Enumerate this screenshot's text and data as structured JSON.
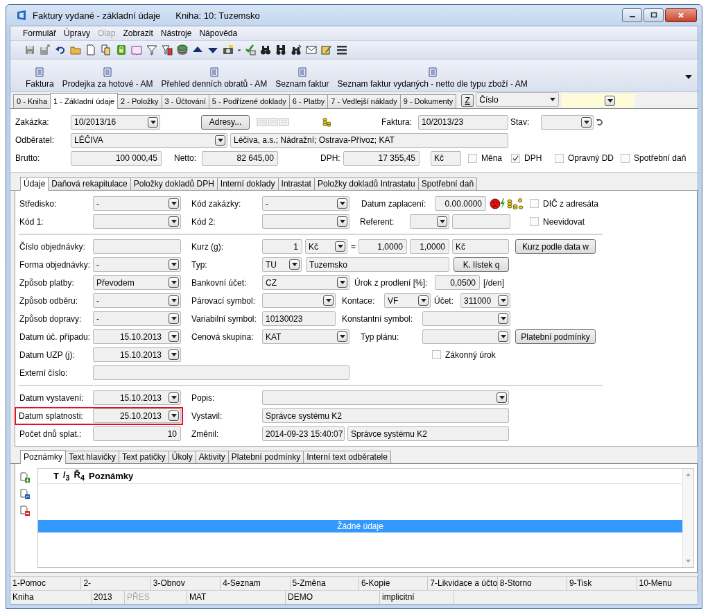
{
  "window": {
    "title": "Faktury vydané - základní údaje",
    "subtitle": "Kniha: 10: Tuzemsko"
  },
  "menu": [
    {
      "label": "Formulář",
      "disabled": false
    },
    {
      "label": "Úpravy",
      "disabled": false
    },
    {
      "label": "Olap",
      "disabled": true
    },
    {
      "label": "Zobrazit",
      "disabled": false
    },
    {
      "label": "Nástroje",
      "disabled": false
    },
    {
      "label": "Nápověda",
      "disabled": false
    }
  ],
  "reports": [
    "Faktura",
    "Prodejka za hotové - AM",
    "Přehled denních obratů - AM",
    "Seznam faktur",
    "Seznam faktur vydaných - netto dle typu zboží - AM"
  ],
  "tabs": [
    {
      "label": "0 - Kniha",
      "selected": false
    },
    {
      "label": "1 - Základní údaje",
      "selected": true
    },
    {
      "label": "2 - Položky",
      "selected": false
    },
    {
      "label": "3 - Účtování",
      "selected": false
    },
    {
      "label": "5 - Podřízené doklady",
      "selected": false
    },
    {
      "label": "6 - Platby",
      "selected": false
    },
    {
      "label": "7 - Vedlejší náklady",
      "selected": false
    },
    {
      "label": "9 - Dokumenty",
      "selected": false
    }
  ],
  "sort": {
    "key": "Z",
    "field": "Číslo"
  },
  "header": {
    "rows": [
      {
        "items": [
          {
            "kind": "label",
            "text": "Zakázka:"
          },
          {
            "kind": "combo",
            "value": "10/2013/16"
          },
          {
            "kind": "button",
            "label": "Adresy..."
          },
          {
            "kind": "pages"
          },
          {
            "kind": "coins"
          },
          {
            "kind": "label",
            "text": "Faktura:"
          },
          {
            "kind": "field",
            "value": "10/2013/23"
          },
          {
            "kind": "label",
            "text": "Stav:"
          },
          {
            "kind": "combo"
          },
          {
            "kind": "undo"
          }
        ]
      },
      {
        "items": [
          {
            "kind": "label",
            "text": "Odběratel:"
          },
          {
            "kind": "combo",
            "value": "LÉČIVA"
          },
          {
            "kind": "field",
            "value": "Léčiva, a.s.; Nádražní; Ostrava-Přívoz; KAT"
          }
        ]
      },
      {
        "items": [
          {
            "kind": "label",
            "text": "Brutto:"
          },
          {
            "kind": "numfield",
            "value": "100 000,45"
          },
          {
            "kind": "label",
            "text": "Netto:"
          },
          {
            "kind": "numfield",
            "value": "82 645,00"
          },
          {
            "kind": "label",
            "text": "DPH:"
          },
          {
            "kind": "numfield",
            "value": "17 355,45"
          },
          {
            "kind": "field",
            "value": "Kč"
          },
          {
            "kind": "check",
            "label": "Měna",
            "checked": false
          },
          {
            "kind": "check",
            "label": "DPH",
            "checked": true
          },
          {
            "kind": "check",
            "label": "Opravný DD",
            "checked": false
          },
          {
            "kind": "check",
            "label": "Spotřební daň",
            "checked": false
          }
        ]
      }
    ]
  },
  "detail_tabs": [
    {
      "label": "Údaje",
      "selected": true
    },
    {
      "label": "Daňová rekapitulace",
      "selected": false
    },
    {
      "label": "Položky dokladů DPH",
      "selected": false
    },
    {
      "label": "Interní doklady",
      "selected": false
    },
    {
      "label": "Intrastat",
      "selected": false
    },
    {
      "label": "Položky dokladů Intrastatu",
      "selected": false
    },
    {
      "label": "Spotřební daň",
      "selected": false
    }
  ],
  "detail": {
    "groups": [
      [
        {
          "items": [
            {
              "kind": "label",
              "text": "Středisko:"
            },
            {
              "kind": "combo",
              "value": "-"
            },
            {
              "kind": "label",
              "text": "Kód zakázky:"
            },
            {
              "kind": "combo",
              "value": "-"
            },
            {
              "kind": "label",
              "text": "Datum zaplacení:"
            },
            {
              "kind": "numfield",
              "value": "0.00.0000"
            },
            {
              "kind": "payment"
            },
            {
              "kind": "check",
              "label": "DIČ z adresáta",
              "checked": false
            }
          ]
        },
        {
          "items": [
            {
              "kind": "label",
              "text": "Kód 1:"
            },
            {
              "kind": "combo"
            },
            {
              "kind": "label",
              "text": "Kód 2:"
            },
            {
              "kind": "combo"
            },
            {
              "kind": "label",
              "text": "Referent:"
            },
            {
              "kind": "combo"
            },
            {
              "kind": "field"
            },
            {
              "kind": "check",
              "label": "Neevidovat",
              "checked": false
            }
          ]
        }
      ],
      [
        {
          "items": [
            {
              "kind": "label",
              "text": "Číslo objednávky:"
            },
            {
              "kind": "field"
            },
            {
              "kind": "label",
              "text": "Kurz (g):"
            },
            {
              "kind": "numfield",
              "value": "1"
            },
            {
              "kind": "combo",
              "value": "Kč"
            },
            {
              "kind": "text",
              "text": "="
            },
            {
              "kind": "numfield",
              "value": "1,0000"
            },
            {
              "kind": "numfield",
              "value": "1,0000"
            },
            {
              "kind": "field",
              "value": "Kč"
            },
            {
              "kind": "button",
              "label": "Kurz podle data w"
            }
          ]
        },
        {
          "items": [
            {
              "kind": "label",
              "text": "Forma objednávky:"
            },
            {
              "kind": "combo",
              "value": "-"
            },
            {
              "kind": "label",
              "text": "Typ:"
            },
            {
              "kind": "combo",
              "value": "TU"
            },
            {
              "kind": "field",
              "value": "Tuzemsko"
            },
            {
              "kind": "button",
              "label": "K. lístek q"
            }
          ]
        },
        {
          "items": [
            {
              "kind": "label",
              "text": "Způsob platby:"
            },
            {
              "kind": "combo",
              "value": "Převodem"
            },
            {
              "kind": "label",
              "text": "Bankovní účet:"
            },
            {
              "kind": "combo",
              "value": "CZ"
            },
            {
              "kind": "label",
              "text": "Úrok z prodlení [%]:"
            },
            {
              "kind": "numfield",
              "value": "0,0500"
            },
            {
              "kind": "text",
              "text": "[/den]"
            }
          ]
        },
        {
          "items": [
            {
              "kind": "label",
              "text": "Způsob odběru:"
            },
            {
              "kind": "combo",
              "value": "-"
            },
            {
              "kind": "label",
              "text": "Párovací symbol:"
            },
            {
              "kind": "combo"
            },
            {
              "kind": "label",
              "text": "Kontace:"
            },
            {
              "kind": "combo",
              "value": "VF"
            },
            {
              "kind": "label",
              "text": "Účet:"
            },
            {
              "kind": "combo",
              "value": "311000"
            }
          ]
        },
        {
          "items": [
            {
              "kind": "label",
              "text": "Způsob dopravy:"
            },
            {
              "kind": "combo",
              "value": "-"
            },
            {
              "kind": "label",
              "text": "Variabilní symbol:"
            },
            {
              "kind": "field",
              "value": "10130023"
            },
            {
              "kind": "label",
              "text": "Konstantní symbol:"
            },
            {
              "kind": "combo"
            }
          ]
        },
        {
          "items": [
            {
              "kind": "label",
              "text": "Datum úč. případu:"
            },
            {
              "kind": "datecombo",
              "value": "15.10.2013"
            },
            {
              "kind": "label",
              "text": "Cenová skupina:"
            },
            {
              "kind": "combo",
              "value": "KAT"
            },
            {
              "kind": "label",
              "text": "Typ plánu:"
            },
            {
              "kind": "combo"
            },
            {
              "kind": "button",
              "label": "Platební podmínky"
            }
          ]
        },
        {
          "items": [
            {
              "kind": "label",
              "text": "Datum UZP (j):"
            },
            {
              "kind": "datecombo",
              "value": "15.10.2013"
            },
            {
              "kind": "check",
              "label": "Zákonný úrok",
              "checked": false
            }
          ]
        },
        {
          "items": [
            {
              "kind": "label",
              "text": "Externí číslo:"
            },
            {
              "kind": "field"
            }
          ]
        }
      ],
      [
        {
          "items": [
            {
              "kind": "label",
              "text": "Datum vystavení:"
            },
            {
              "kind": "datecombo",
              "value": "15.10.2013"
            },
            {
              "kind": "label",
              "text": "Popis:"
            },
            {
              "kind": "combo"
            }
          ]
        },
        {
          "items": [
            {
              "kind": "group",
              "highlighted": true,
              "items": [
                {
                  "kind": "label",
                  "text": "Datum splatnosti:"
                },
                {
                  "kind": "datecombo",
                  "value": "25.10.2013"
                }
              ]
            },
            {
              "kind": "label",
              "text": "Vystavil:"
            },
            {
              "kind": "field",
              "value": "Správce systému K2"
            }
          ]
        },
        {
          "items": [
            {
              "kind": "label",
              "text": "Počet dnů splat.:"
            },
            {
              "kind": "numfield",
              "value": "10"
            },
            {
              "kind": "label",
              "text": "Změnil:"
            },
            {
              "kind": "field",
              "value": "2014-09-23 15:40:07"
            },
            {
              "kind": "field",
              "value": "Správce systému K2"
            }
          ]
        }
      ]
    ]
  },
  "notes": {
    "tabs": [
      {
        "label": "Poznámky",
        "selected": true
      },
      {
        "label": "Text hlavičky",
        "selected": false
      },
      {
        "label": "Text patičky",
        "selected": false
      },
      {
        "label": "Úkoly",
        "selected": false
      },
      {
        "label": "Aktivity",
        "selected": false
      },
      {
        "label": "Platební podmínky",
        "selected": false
      },
      {
        "label": "Interní text odběratele",
        "selected": false
      }
    ],
    "columns": [
      "T",
      "/$_{3}$",
      "Ř$_{4}$",
      "Poznámky"
    ],
    "empty_text": "Žádné údaje"
  },
  "function_keys": [
    "1-Pomoc",
    "2-",
    "3-Obnov",
    "4-Seznam",
    "5-Změna",
    "6-Kopie",
    "7-Likvidace a účto",
    "8-Storno",
    "9-Tisk",
    "10-Menu"
  ],
  "status_bar": [
    {
      "text": "Kniha",
      "disabled": false
    },
    {
      "text": "2013",
      "disabled": false
    },
    {
      "text": "PŘES",
      "disabled": true
    },
    {
      "text": "MAT",
      "disabled": false
    },
    {
      "text": "DEMO",
      "disabled": false
    },
    {
      "text": "implicitní",
      "disabled": false
    }
  ]
}
